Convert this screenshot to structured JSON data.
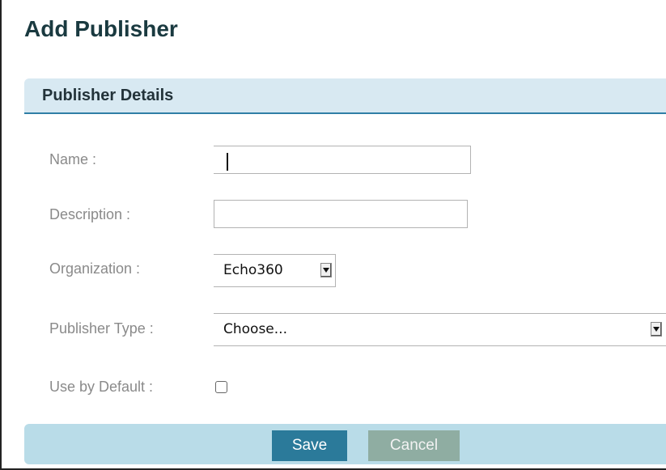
{
  "page": {
    "title": "Add Publisher"
  },
  "section": {
    "title": "Publisher Details"
  },
  "form": {
    "name": {
      "label": "Name :",
      "value": "",
      "required": true
    },
    "description": {
      "label": "Description :",
      "value": "",
      "required": false
    },
    "organization": {
      "label": "Organization :",
      "selected": "Echo360",
      "required": true
    },
    "publisher_type": {
      "label": "Publisher Type :",
      "selected": "Choose...",
      "required": true
    },
    "use_by_default": {
      "label": "Use by Default :",
      "checked": false
    }
  },
  "actions": {
    "save_label": "Save",
    "cancel_label": "Cancel"
  },
  "colors": {
    "required_marker": "#f26b1d",
    "section_header_bg": "#d8e9f2",
    "button_bar_bg": "#b9dce8",
    "save_bg": "#2b7a9a",
    "cancel_bg": "#8fada2"
  },
  "icons": {
    "select_arrow": "chevron-down-icon"
  }
}
